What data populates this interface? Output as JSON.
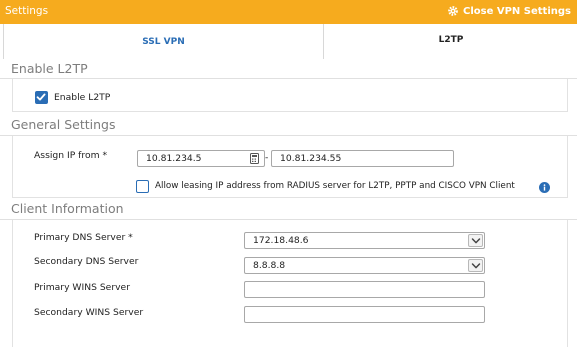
{
  "window": {
    "title": "Settings",
    "close_label": "Close VPN Settings"
  },
  "tabs": [
    {
      "label": "SSL VPN",
      "active": false
    },
    {
      "label": "L2TP",
      "active": true
    }
  ],
  "enable_section": {
    "title": "Enable L2TP",
    "checkbox_label": "Enable L2TP",
    "checked": true
  },
  "general_section": {
    "title": "General Settings",
    "assign_ip_label": "Assign IP from *",
    "ip_start": "10.81.234.5",
    "ip_separator": "-",
    "ip_end": "10.81.234.55",
    "radius_label": "Allow leasing IP address from RADIUS server for L2TP, PPTP and CISCO VPN Client",
    "radius_checked": false
  },
  "client_section": {
    "title": "Client Information",
    "primary_dns_label": "Primary DNS Server *",
    "primary_dns_value": "172.18.48.6",
    "secondary_dns_label": "Secondary DNS Server",
    "secondary_dns_value": "8.8.8.8",
    "primary_wins_label": "Primary WINS Server",
    "primary_wins_value": "",
    "secondary_wins_label": "Secondary WINS Server",
    "secondary_wins_value": ""
  },
  "colors": {
    "titlebar": "#f6ab1e",
    "accent_blue": "#2a6db5",
    "section_title": "#7d7d7d"
  },
  "icons": {
    "close": "gear-icon",
    "checkbox": "checkmark-icon",
    "ip_picker": "calculator-icon",
    "info": "info-icon",
    "dropdown": "chevron-down-icon"
  }
}
